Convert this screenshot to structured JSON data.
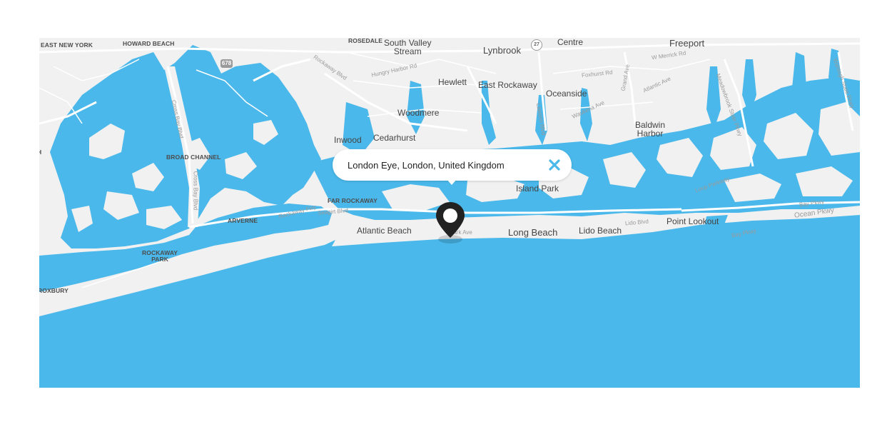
{
  "map": {
    "water_color": "#4ab8ea",
    "land_color": "#f1f1f1",
    "road_color": "#ffffff",
    "labels": {
      "east_new_york": "EAST NEW YORK",
      "howard_beach": "HOWARD BEACH",
      "rosedale": "ROSEDALE",
      "south_valley_stream": "South Valley\nStream",
      "lynbrook": "Lynbrook",
      "rockville_centre": "Rockville\nCentre",
      "freeport": "Freeport",
      "hewlett": "Hewlett",
      "east_rockaway": "East Rockaway",
      "oceanside": "Oceanside",
      "woodmere": "Woodmere",
      "baldwin_harbor": "Baldwin\nHarbor",
      "inwood": "Inwood",
      "cedarhurst": "Cedarhurst",
      "broad_channel": "BROAD CHANNEL",
      "island_park": "Island Park",
      "far_rockaway": "FAR ROCKAWAY",
      "arverne": "ARVERNE",
      "atlantic_beach": "Atlantic Beach",
      "long_beach": "Long Beach",
      "lido_beach": "Lido Beach",
      "point_lookout": "Point Lookout",
      "rockaway_park": "ROCKAWAY\nPARK",
      "roxbury": "ROXBURY",
      "edge_h": "H"
    },
    "roads": {
      "rockaway_blvd": "Rockaway Blvd",
      "hungry_harbor_rd": "Hungry Harbor Rd",
      "w_merrick_rd": "W Merrick Rd",
      "foxhurst_rd": "Foxhurst Rd",
      "grand_ave": "Grand Ave",
      "atlantic_ave": "Atlantic Ave",
      "waukena_ave": "Waukena Ave",
      "lawson_blvd": "Lawson Blvd",
      "cross_bay_blvd": "Cross Bay Blvd",
      "rockaway_fwy": "Rockaway Fwy",
      "seagirt_blvd": "Seagirt Blvd",
      "park_ave": "Park Ave",
      "lido_blvd": "Lido Blvd",
      "loop_pkwy": "Loop Parkway",
      "ocean_pkwy": "Ocean Pkwy",
      "bay_pkwy": "Bay Pkwy",
      "bay_pkwy_2": "Bay Pkwy",
      "meadowbrook_pkwy": "Meadowbrook State Pkwy",
      "wantagh_pkwy": "Wantagh State Pkwy",
      "cross_bay_2": "Cross Bay Blvd",
      "shield_678": "678",
      "shield_27": "27"
    }
  },
  "info_window": {
    "address": "London Eye, London, United Kingdom",
    "close_icon": "close-icon"
  },
  "marker": {
    "icon": "map-pin-icon",
    "color": "#222222"
  }
}
